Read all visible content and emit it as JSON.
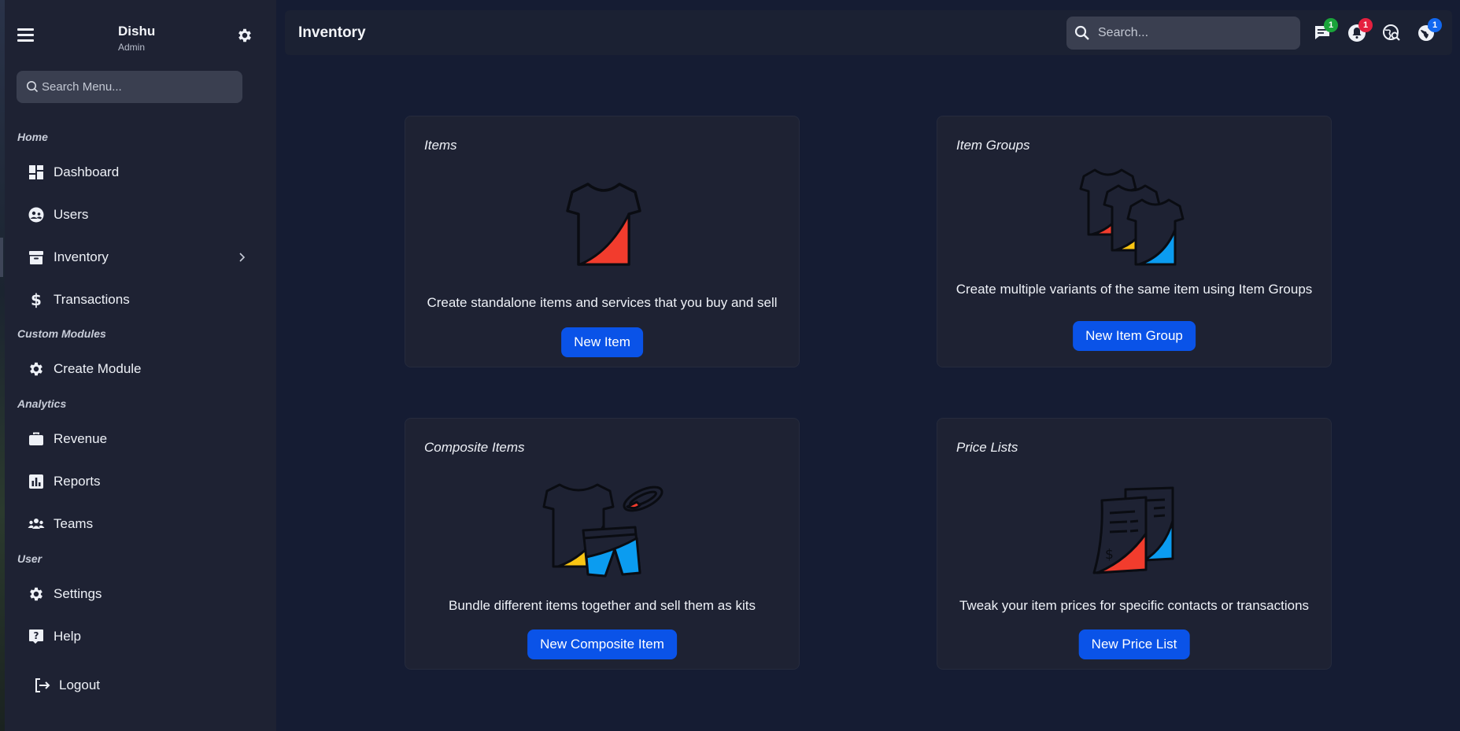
{
  "user": {
    "name": "Dishu",
    "role": "Admin"
  },
  "sidebar": {
    "search_placeholder": "Search Menu...",
    "sections": {
      "home": "Home",
      "custom_modules": "Custom Modules",
      "analytics": "Analytics",
      "user": "User"
    },
    "items": [
      {
        "label": "Dashboard",
        "icon": "dashboard-icon"
      },
      {
        "label": "Users",
        "icon": "users-icon"
      },
      {
        "label": "Inventory",
        "icon": "inventory-icon"
      },
      {
        "label": "Transactions",
        "icon": "dollar-icon"
      },
      {
        "label": "Create Module",
        "icon": "gear-icon"
      },
      {
        "label": "Revenue",
        "icon": "briefcase-icon"
      },
      {
        "label": "Reports",
        "icon": "bar-chart-icon"
      },
      {
        "label": "Teams",
        "icon": "teams-icon"
      },
      {
        "label": "Settings",
        "icon": "gear-icon"
      },
      {
        "label": "Help",
        "icon": "help-icon"
      },
      {
        "label": "Logout",
        "icon": "logout-icon"
      }
    ]
  },
  "header": {
    "title": "Inventory",
    "search_placeholder": "Search...",
    "badges": {
      "messages": "1",
      "notifications": "1",
      "globe": "1"
    },
    "badge_colors": {
      "messages": "#1aa33a",
      "notifications": "#e5203f",
      "globe": "#1268f0"
    }
  },
  "cards": [
    {
      "title": "Items",
      "description": "Create standalone items and services that you buy and sell",
      "button": "New Item"
    },
    {
      "title": "Item Groups",
      "description": "Create multiple variants of the same item using Item Groups",
      "button": "New Item Group"
    },
    {
      "title": "Composite Items",
      "description": "Bundle different items together and sell them as kits",
      "button": "New Composite Item"
    },
    {
      "title": "Price Lists",
      "description": "Tweak your item prices for specific contacts or transactions",
      "button": "New Price List"
    }
  ],
  "colors": {
    "accent": "#0a53e8",
    "illus_red": "#f23c2d",
    "illus_yellow": "#f9c513",
    "illus_blue": "#0b9cf0"
  }
}
